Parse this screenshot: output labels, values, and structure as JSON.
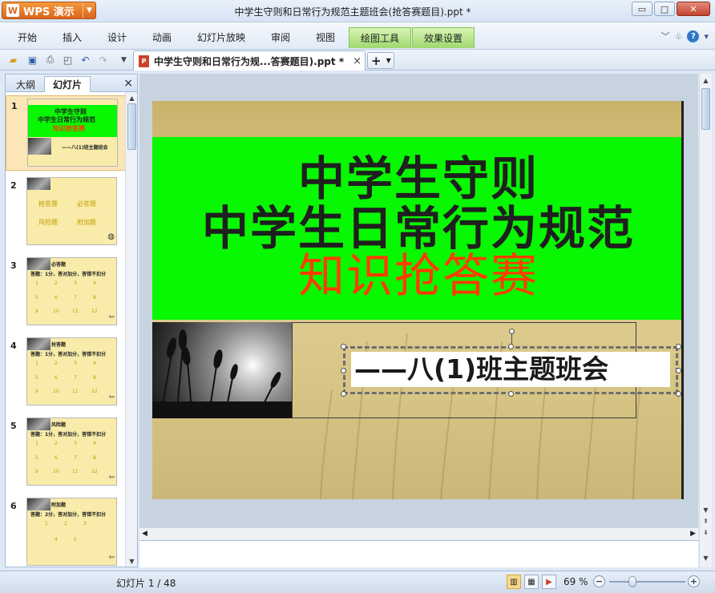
{
  "app": {
    "button_label": "WPS 演示",
    "logo_glyph": "W",
    "window_title": "中学生守则和日常行为规范主题班会(抢答赛题目).ppt *"
  },
  "window_controls": {
    "minimize": "▭",
    "maximize": "□",
    "close": "✕"
  },
  "menu": {
    "items": [
      "开始",
      "插入",
      "设计",
      "动画",
      "幻灯片放映",
      "审阅",
      "视图"
    ],
    "context_tabs": [
      "绘图工具",
      "效果设置"
    ],
    "context_color": "#9fd86f"
  },
  "toolbar": {
    "doc_tab_label": "中学生守则和日常行为规...答赛题目).ppt *",
    "doc_tab_close": "×",
    "new_tab": "+"
  },
  "panel": {
    "tabs": [
      "大纲",
      "幻灯片"
    ],
    "active_tab": "幻灯片",
    "close": "×"
  },
  "thumbnails": [
    {
      "num": "1",
      "lines": [
        "中学生守则",
        "中学生日常行为规范",
        "知识抢答赛",
        "——八(1)班主题班会"
      ]
    },
    {
      "num": "2",
      "lines": [
        "抢答题",
        "必答题",
        "风险题",
        "附加题"
      ]
    },
    {
      "num": "3",
      "lines": [
        "必答题",
        "答题：1分，答对加分，答错不扣分"
      ],
      "numbers": [
        "1",
        "2",
        "3",
        "4",
        "5",
        "6",
        "7",
        "8",
        "9",
        "10",
        "11",
        "12"
      ]
    },
    {
      "num": "4",
      "lines": [
        "抢答题",
        "答题：1分，答对加分，答错不扣分"
      ],
      "numbers": [
        "1",
        "2",
        "3",
        "4",
        "5",
        "6",
        "7",
        "8",
        "9",
        "10",
        "11",
        "12"
      ]
    },
    {
      "num": "5",
      "lines": [
        "风险题",
        "答题：1分，答对加分，答错不扣分"
      ],
      "numbers": [
        "1",
        "2",
        "3",
        "4",
        "5",
        "6",
        "7",
        "8",
        "9",
        "10",
        "11",
        "12"
      ]
    },
    {
      "num": "6",
      "lines": [
        "附加题",
        "答题：2分，答对加分，答错不扣分"
      ],
      "numbers": [
        "1",
        "2",
        "3",
        "4",
        "5"
      ]
    }
  ],
  "slide": {
    "title_line1": "中学生守则",
    "title_line2": "中学生日常行为规范",
    "title_line3": "知识抢答赛",
    "subtitle": "——八(1)班主题班会",
    "band_color": "#08f702",
    "highlight_color": "#ff3c00"
  },
  "status": {
    "slide_indicator": "幻灯片 1 / 48",
    "zoom": "69 %",
    "zoom_fraction": 0.3
  }
}
